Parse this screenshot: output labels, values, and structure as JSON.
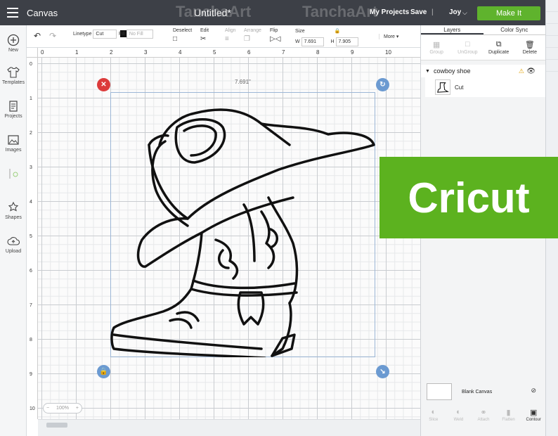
{
  "topbar": {
    "app_name": "Canvas",
    "document_title": "Untitled*",
    "my_projects": "My Projects",
    "save": "Save",
    "separator": "|",
    "user": "Joy",
    "make_it": "Make It"
  },
  "sidebar": {
    "items": [
      {
        "label": "New",
        "icon": "plus-circle-icon"
      },
      {
        "label": "Templates",
        "icon": "shirt-icon"
      },
      {
        "label": "Projects",
        "icon": "book-icon"
      },
      {
        "label": "Images",
        "icon": "image-icon"
      },
      {
        "label": "Shapes",
        "icon": "shapes-icon"
      },
      {
        "label": "Upload",
        "icon": "cloud-upload-icon"
      }
    ]
  },
  "toolbar": {
    "linetype_label": "Linetype",
    "linetype_value": "Cut",
    "fill_label": "Fill",
    "fill_value": "No Fill",
    "deselect": "Deselect",
    "edit": "Edit",
    "align": "Align",
    "arrange": "Arrange",
    "flip": "Flip",
    "size": "Size",
    "width_label": "W",
    "width_value": "7.691",
    "height_label": "H",
    "height_value": "7.905",
    "more": "More"
  },
  "ruler": {
    "h_ticks": [
      "0",
      "1",
      "2",
      "3",
      "4",
      "5",
      "6",
      "7",
      "8",
      "9",
      "10"
    ],
    "v_ticks": [
      "0",
      "1",
      "2",
      "3",
      "4",
      "5",
      "6",
      "7",
      "8",
      "9",
      "10"
    ]
  },
  "canvas": {
    "dimension_label": "7.691\"",
    "zoom_value": "100%"
  },
  "panel": {
    "tabs": [
      "Layers",
      "Color Sync"
    ],
    "actions": [
      "Group",
      "UnGroup",
      "Duplicate",
      "Delete"
    ],
    "layer_name": "cowboy shoe",
    "sublayer_name": "Cut",
    "blank_canvas": "Blank Canvas",
    "bottom_actions": [
      "Slice",
      "Weld",
      "Attach",
      "Flatten",
      "Contour"
    ]
  },
  "overlay": {
    "brand_badge": "Cricut",
    "watermark": "TanchaArt"
  },
  "colors": {
    "topbar": "#3d4047",
    "make_it": "#5fb32d",
    "badge": "#5cb21f",
    "close_handle": "#dc3b3b",
    "handle": "#6b9ad1"
  }
}
